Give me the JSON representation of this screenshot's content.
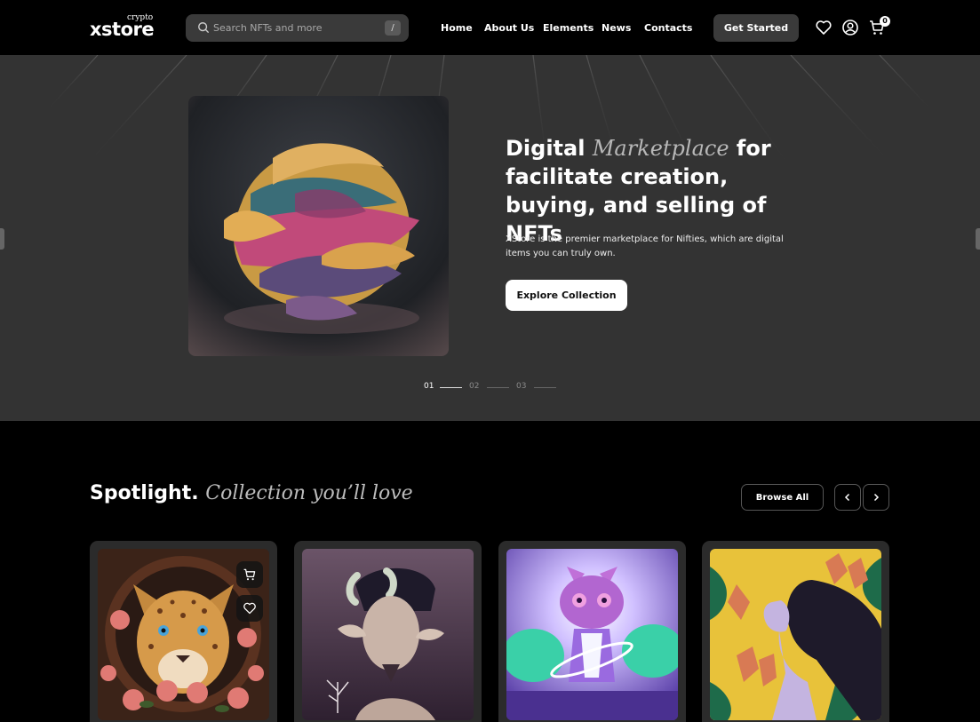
{
  "header": {
    "logo_text": "xstore",
    "logo_sup": "crypto",
    "search_placeholder": "Search NFTs and more",
    "search_shortcut": "/",
    "nav": [
      "Home",
      "About Us",
      "Elements",
      "News",
      "Contacts"
    ],
    "cta_label": "Get Started",
    "cart_count": "0",
    "icons": [
      "search-icon",
      "heart-icon",
      "user-icon",
      "cart-icon"
    ]
  },
  "hero": {
    "title_part1": "Digital",
    "title_emphasis": "Marketplace",
    "title_part2": "for facilitate creation, buying, and selling of NFTs",
    "description": "XStore is the premier marketplace for Nifties, which are digital items you can truly own.",
    "button_label": "Explore Collection",
    "slides": [
      "01",
      "02",
      "03"
    ],
    "active_slide": 0
  },
  "spotlight": {
    "title": "Spotlight.",
    "subtitle": "Collection you’ll love",
    "browse_label": "Browse All",
    "prev_icon": "chevron-left-icon",
    "next_icon": "chevron-right-icon",
    "card_actions": [
      "cart-icon",
      "heart-icon"
    ]
  },
  "colors": {
    "background": "#000000",
    "hero_bg": "#333333",
    "accent_muted": "#3a3a3a",
    "button_light": "#ffffff"
  }
}
